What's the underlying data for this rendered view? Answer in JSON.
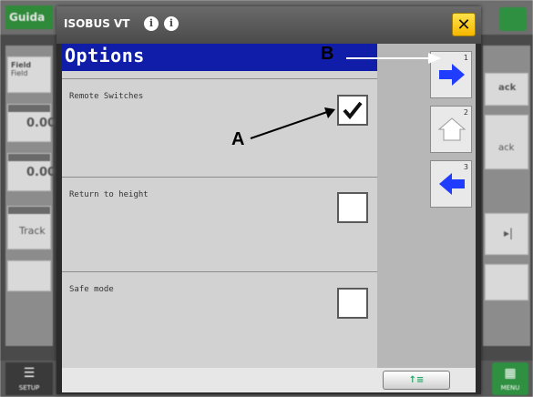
{
  "background_app": {
    "tab_label": "Guida",
    "left_fields": [
      {
        "label": "Field",
        "sub": "Field"
      },
      {
        "value": "0.00"
      },
      {
        "value": "0.00"
      },
      {
        "label": "Track"
      }
    ],
    "right_fields": [
      {
        "label": "ack"
      },
      {
        "label": "ack"
      }
    ],
    "bottom_left_label": "SETUP",
    "bottom_right_label": "MENU"
  },
  "modal": {
    "title": "ISOBUS VT",
    "info_icons": [
      "i",
      "i"
    ],
    "close_symbol": "✕",
    "header": "Options",
    "rows": [
      {
        "label": "Remote Switches",
        "checked": true
      },
      {
        "label": "Return to height",
        "checked": false
      },
      {
        "label": "Safe mode",
        "checked": false
      }
    ],
    "softkeys": [
      {
        "name": "next-arrow",
        "mini": "1"
      },
      {
        "name": "home",
        "mini": "2"
      },
      {
        "name": "back-arrow",
        "mini": "3"
      }
    ],
    "bottom_nav_label": "↑≡"
  },
  "annotations": {
    "a": "A",
    "b": "B"
  },
  "colors": {
    "header_blue": "#0f1da8",
    "arrow_blue": "#1f3cff",
    "close_yellow": "#f5b800"
  }
}
